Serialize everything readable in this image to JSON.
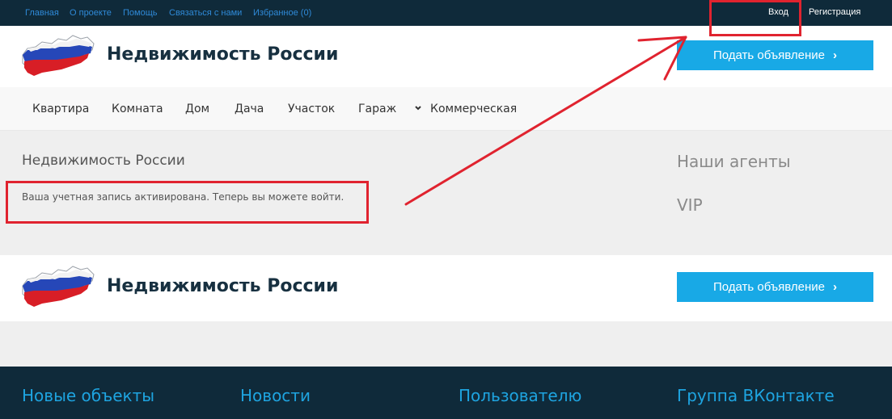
{
  "topbar": {
    "links": [
      "Главная",
      "О проекте",
      "Помощь",
      "Связаться с нами",
      "Избранное (0)"
    ],
    "login": "Вход",
    "register": "Регистрация"
  },
  "header": {
    "title": "Недвижимость России",
    "cta_label": "Подать объявление",
    "cta_chevron": "›"
  },
  "nav": {
    "items": [
      "Квартира",
      "Комната",
      "Дом",
      "Дача",
      "Участок",
      "Гараж",
      "Коммерческая"
    ],
    "dropdown_marker": "⌄"
  },
  "content": {
    "title": "Недвижимость России",
    "message": "Ваша учетная запись активирована. Теперь вы можете войти."
  },
  "sidebar": {
    "agents_title": "Наши агенты",
    "vip_title": "VIP"
  },
  "footer": {
    "site_title": "Недвижимость России",
    "cta_label": "Подать объявление",
    "columns": [
      "Новые объекты",
      "Новости",
      "Пользователю",
      "Группа ВКонтакте"
    ]
  },
  "colors": {
    "topbar_bg": "#0f2a3a",
    "accent_blue": "#18a9e6",
    "annotation_red": "#e0232f"
  }
}
